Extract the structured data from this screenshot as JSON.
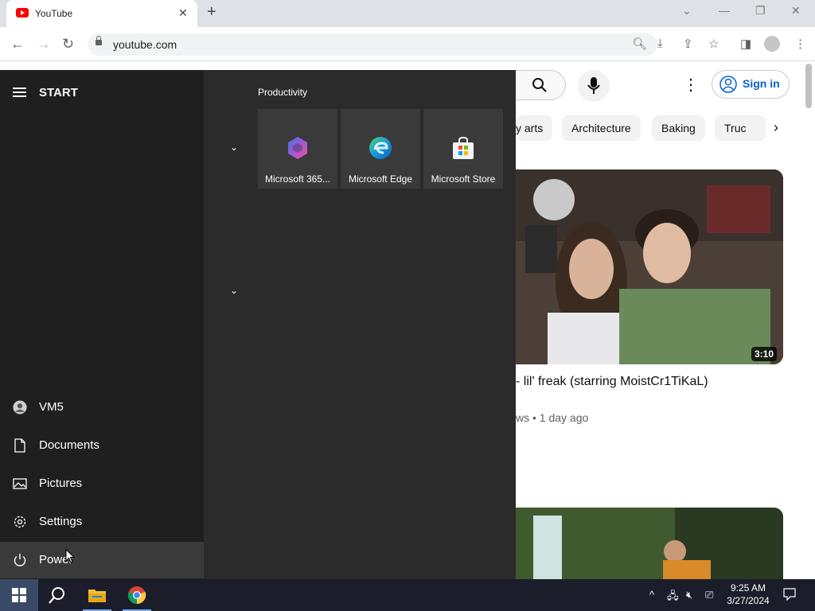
{
  "browser": {
    "tab_title": "YouTube",
    "new_tab": "+",
    "url": "youtube.com"
  },
  "youtube": {
    "chips": [
      "y arts",
      "Architecture",
      "Baking",
      "Truc"
    ],
    "sign_in": "Sign in",
    "video": {
      "duration": "3:10",
      "title": "- lil' freak (starring MoistCr1TiKaL)",
      "meta": "ws • 1 day ago"
    }
  },
  "start_menu": {
    "title": "START",
    "group_label": "Productivity",
    "tiles": [
      {
        "label": "Microsoft 365...",
        "icon": "microsoft-365-icon"
      },
      {
        "label": "Microsoft Edge",
        "icon": "edge-icon"
      },
      {
        "label": "Microsoft Store",
        "icon": "store-icon"
      }
    ],
    "nav": [
      {
        "label": "VM5",
        "icon": "user-icon"
      },
      {
        "label": "Documents",
        "icon": "document-icon"
      },
      {
        "label": "Pictures",
        "icon": "pictures-icon"
      },
      {
        "label": "Settings",
        "icon": "gear-icon"
      },
      {
        "label": "Power",
        "icon": "power-icon"
      }
    ]
  },
  "taskbar": {
    "time": "9:25 AM",
    "date": "3/27/2024"
  },
  "colors": {
    "start_left": "#1f1f1f",
    "start_right": "#2b2b2b",
    "taskbar": "#1b1d2a",
    "youtube_red": "#ff0000",
    "signin_blue": "#065fd4"
  }
}
